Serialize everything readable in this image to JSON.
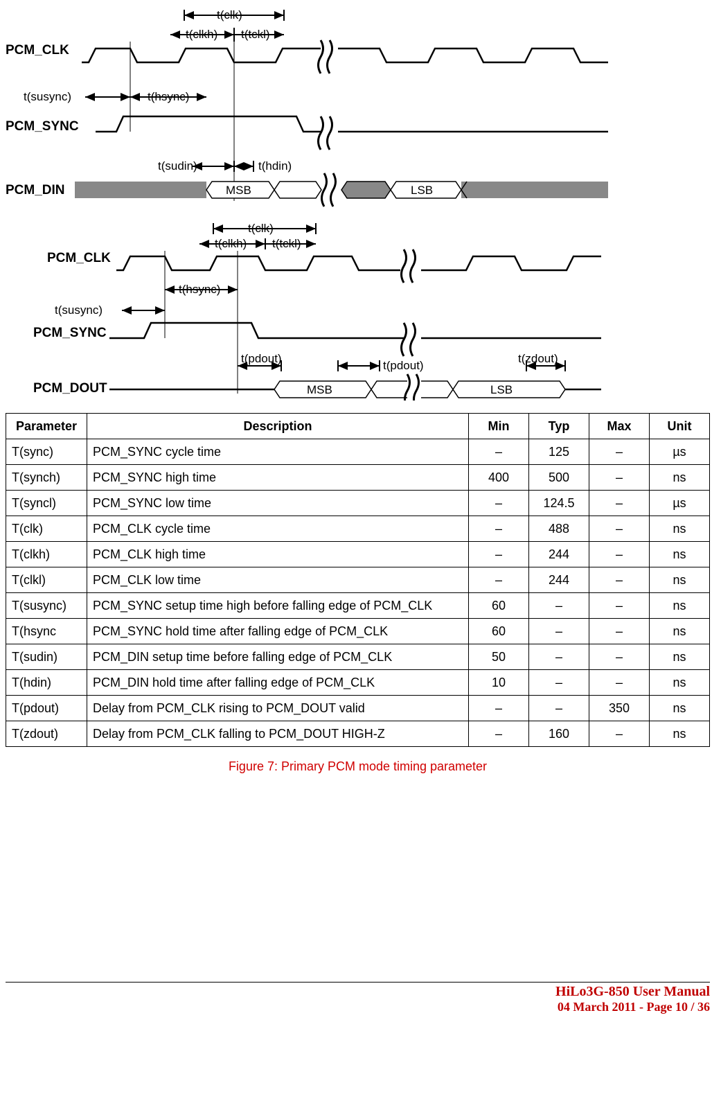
{
  "diagram1": {
    "signals": {
      "clk": "PCM_CLK",
      "sync": "PCM_SYNC",
      "din": "PCM_DIN"
    },
    "labels": {
      "tclk": "t(clk)",
      "tclkh": "t(clkh)",
      "ttckl": "t(tckl)",
      "tsusync": "t(susync)",
      "thsync": "t(hsync)",
      "tsudin": "t(sudin)",
      "thdin": "t(hdin)",
      "msb": "MSB",
      "lsb": "LSB"
    }
  },
  "diagram2": {
    "signals": {
      "clk": "PCM_CLK",
      "sync": "PCM_SYNC",
      "dout": "PCM_DOUT"
    },
    "labels": {
      "tclk": "t(clk)",
      "tclkh": "t(clkh)",
      "ttckl": "t(tckl)",
      "tsusync": "t(susync)",
      "thsync": "t(hsync)",
      "tpdout": "t(pdout)",
      "tzdout": "t(zdout)",
      "msb": "MSB",
      "lsb": "LSB"
    }
  },
  "table": {
    "headers": {
      "param": "Parameter",
      "desc": "Description",
      "min": "Min",
      "typ": "Typ",
      "max": "Max",
      "unit": "Unit"
    },
    "rows": [
      {
        "p": "T(sync)",
        "d": "PCM_SYNC cycle time",
        "min": "–",
        "typ": "125",
        "max": "–",
        "u": "µs"
      },
      {
        "p": "T(synch)",
        "d": "PCM_SYNC high time",
        "min": "400",
        "typ": "500",
        "max": "–",
        "u": "ns"
      },
      {
        "p": "T(syncl)",
        "d": "PCM_SYNC low time",
        "min": "–",
        "typ": "124.5",
        "max": "–",
        "u": "µs"
      },
      {
        "p": "T(clk)",
        "d": "PCM_CLK cycle time",
        "min": "–",
        "typ": "488",
        "max": "–",
        "u": "ns"
      },
      {
        "p": "T(clkh)",
        "d": "PCM_CLK high time",
        "min": "–",
        "typ": "244",
        "max": "–",
        "u": "ns"
      },
      {
        "p": "T(clkl)",
        "d": "PCM_CLK low time",
        "min": "–",
        "typ": "244",
        "max": "–",
        "u": "ns"
      },
      {
        "p": "T(susync)",
        "d": "PCM_SYNC setup time high before falling edge of PCM_CLK",
        "min": "60",
        "typ": "–",
        "max": "–",
        "u": "ns"
      },
      {
        "p": "T(hsync",
        "d": "PCM_SYNC hold time after falling edge of PCM_CLK",
        "min": "60",
        "typ": "–",
        "max": "–",
        "u": "ns"
      },
      {
        "p": "T(sudin)",
        "d": "PCM_DIN setup time before falling edge of PCM_CLK",
        "min": "50",
        "typ": "–",
        "max": "–",
        "u": "ns"
      },
      {
        "p": "T(hdin)",
        "d": "PCM_DIN hold time after falling edge of PCM_CLK",
        "min": "10",
        "typ": "–",
        "max": "–",
        "u": "ns"
      },
      {
        "p": "T(pdout)",
        "d": "Delay from PCM_CLK rising to PCM_DOUT valid",
        "min": "–",
        "typ": "–",
        "max": "350",
        "u": "ns"
      },
      {
        "p": "T(zdout)",
        "d": "Delay from PCM_CLK falling to PCM_DOUT HIGH-Z",
        "min": "–",
        "typ": "160",
        "max": "–",
        "u": "ns"
      }
    ]
  },
  "caption": "Figure 7: Primary PCM mode timing parameter",
  "footer": {
    "title": "HiLo3G-850 User Manual",
    "date": "04 March 2011 -   Page 10 / 36"
  }
}
